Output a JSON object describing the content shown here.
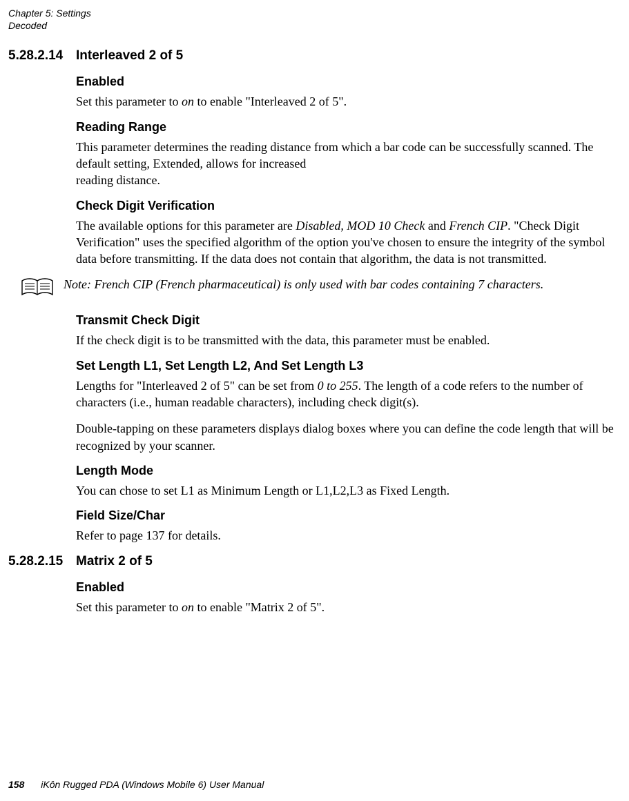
{
  "running_head": {
    "line1": "Chapter 5: Settings",
    "line2": "Decoded"
  },
  "section1": {
    "number": "5.28.2.14",
    "title": "Interleaved 2 of 5",
    "enabled": {
      "heading": "Enabled",
      "body_a": "Set this parameter to ",
      "body_on": "on",
      "body_b": " to enable \"Interleaved 2 of 5\"."
    },
    "reading_range": {
      "heading": "Reading Range",
      "body": "This parameter determines the reading distance from which a bar code can be successfully scanned. The default setting, Extended, allows for increased",
      "body2": "reading distance."
    },
    "check_digit": {
      "heading": "Check Digit Verification",
      "body_a": "The available options for this parameter are ",
      "opts": "Disabled, MOD 10 Check",
      "body_and": " and ",
      "opt2": "French CIP",
      "body_b": ". \"Check Digit Verification\" uses the specified algorithm of the option you've chosen to ensure the integrity of the symbol data before transmitting. If the data does not contain that algorithm, the data is not transmitted."
    },
    "note": {
      "label": "Note: ",
      "body": "French CIP (French pharmaceutical) is only used with bar codes containing 7 characters."
    },
    "transmit": {
      "heading": "Transmit Check Digit",
      "body": "If the check digit is to be transmitted with the data, this parameter must be enabled."
    },
    "set_length": {
      "heading": "Set Length L1, Set Length L2, And Set Length L3",
      "body_a": "Lengths for \"Interleaved 2 of 5\" can be set from ",
      "range": "0 to 255",
      "body_b": ". The length of a code refers to the number of characters (i.e., human readable characters), including check digit(s).",
      "body2": "Double-tapping on these parameters displays dialog boxes where you can define the code length that will be recognized by your scanner."
    },
    "length_mode": {
      "heading": "Length Mode",
      "body": "You can chose to set L1 as Minimum Length or L1,L2,L3 as Fixed Length."
    },
    "field_size": {
      "heading": "Field Size/Char",
      "body": "Refer to page 137 for details."
    }
  },
  "section2": {
    "number": "5.28.2.15",
    "title": "Matrix 2 of 5",
    "enabled": {
      "heading": "Enabled",
      "body_a": "Set this parameter to ",
      "body_on": "on",
      "body_b": " to enable \"Matrix 2 of 5\"."
    }
  },
  "footer": {
    "page": "158",
    "title": "iKôn Rugged PDA (Windows Mobile 6) User Manual"
  }
}
